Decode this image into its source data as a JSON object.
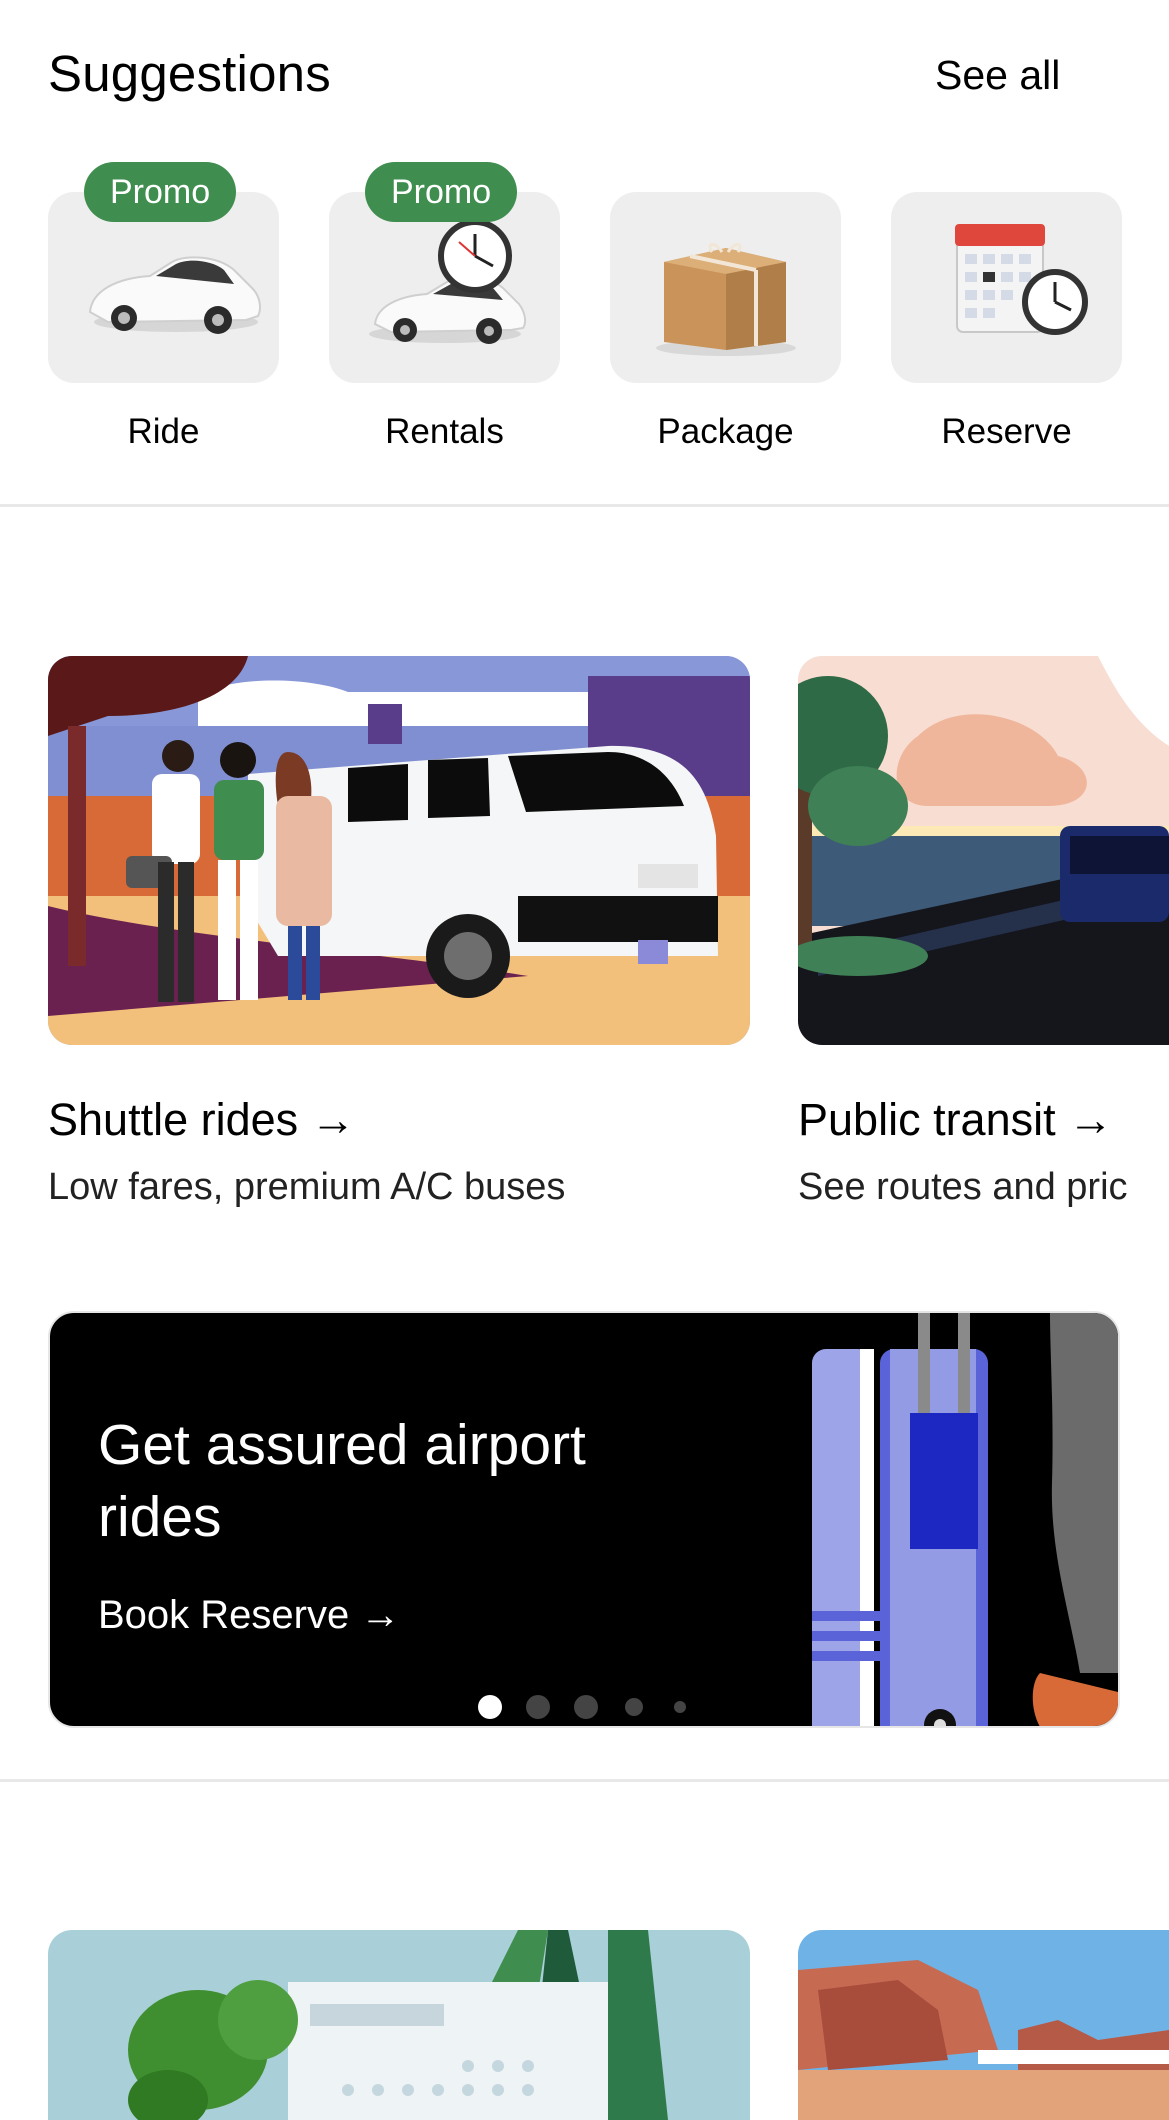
{
  "suggestions": {
    "title": "Suggestions",
    "see_all": "See all",
    "items": [
      {
        "label": "Ride",
        "badge": "Promo",
        "icon": "car-icon"
      },
      {
        "label": "Rentals",
        "badge": "Promo",
        "icon": "car-clock-icon"
      },
      {
        "label": "Package",
        "badge": "",
        "icon": "package-icon"
      },
      {
        "label": "Reserve",
        "badge": "",
        "icon": "calendar-clock-icon"
      }
    ]
  },
  "cards": [
    {
      "title": "Shuttle rides →",
      "subtitle": "Low fares, premium A/C buses"
    },
    {
      "title": "Public transit →",
      "subtitle": "See routes and pric"
    }
  ],
  "banner": {
    "title": "Get assured airport rides",
    "cta": "Book Reserve →",
    "carousel_total": 5,
    "carousel_active": 1
  },
  "colors": {
    "promo_green": "#3f8e4f",
    "tile_bg": "#eeeeee",
    "banner_bg": "#000000"
  }
}
